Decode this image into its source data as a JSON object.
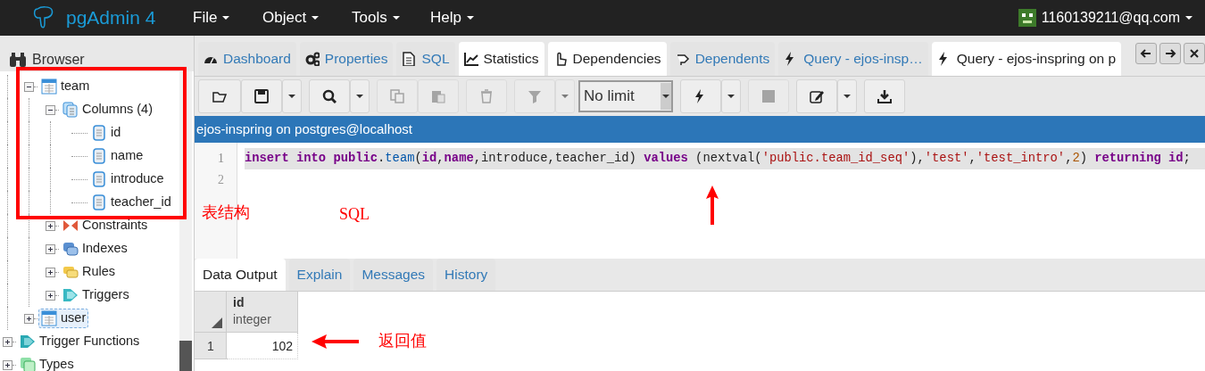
{
  "navbar": {
    "app_name": "pgAdmin 4",
    "menus": [
      "File",
      "Object",
      "Tools",
      "Help"
    ],
    "user": "1160139211@qq.com"
  },
  "browser": {
    "title": "Browser",
    "tables": [
      {
        "label": "team",
        "kind": "table",
        "expanded": true,
        "selected": false,
        "children": [
          {
            "label": "Columns (4)",
            "kind": "columns",
            "expanded": true,
            "selected": false,
            "children": [
              {
                "label": "id",
                "kind": "column",
                "selected": false
              },
              {
                "label": "name",
                "kind": "column",
                "selected": false
              },
              {
                "label": "introduce",
                "kind": "column",
                "selected": false
              },
              {
                "label": "teacher_id",
                "kind": "column",
                "selected": false
              }
            ]
          },
          {
            "label": "Constraints",
            "kind": "constraints",
            "expanded": false,
            "selected": false
          },
          {
            "label": "Indexes",
            "kind": "indexes",
            "expanded": false,
            "selected": false
          },
          {
            "label": "Rules",
            "kind": "rules",
            "expanded": false,
            "selected": false
          },
          {
            "label": "Triggers",
            "kind": "triggers",
            "expanded": false,
            "selected": false
          }
        ]
      },
      {
        "label": "user",
        "kind": "table",
        "expanded": false,
        "selected": true
      }
    ],
    "schema_items": [
      {
        "label": "Trigger Functions",
        "kind": "trigger_functions",
        "expanded": false,
        "selected": false
      },
      {
        "label": "Types",
        "kind": "types",
        "expanded": false,
        "selected": false
      }
    ]
  },
  "tabs": [
    {
      "label": "Dashboard",
      "kind": "dashboard",
      "selected": false
    },
    {
      "label": "Properties",
      "kind": "properties",
      "selected": false
    },
    {
      "label": "SQL",
      "kind": "sql",
      "selected": false
    },
    {
      "label": "Statistics",
      "kind": "statistics",
      "selected": true
    },
    {
      "label": "Dependencies",
      "kind": "dependencies",
      "selected": true
    },
    {
      "label": "Dependents",
      "kind": "dependents",
      "selected": false
    },
    {
      "label": "Query - ejos-insp…",
      "kind": "query",
      "selected": false
    },
    {
      "label": "Query - ejos-inspring on p",
      "kind": "query",
      "selected": true
    }
  ],
  "toolbar": {
    "row_limit": "No limit"
  },
  "connection": "ejos-inspring on postgres@localhost",
  "editor": {
    "lines": [
      {
        "number": "1",
        "active": true
      },
      {
        "number": "2",
        "active": false
      }
    ],
    "tokens": [
      {
        "kind": "keyword",
        "text": "insert "
      },
      {
        "kind": "keyword",
        "text": "into "
      },
      {
        "kind": "keyword",
        "text": "public"
      },
      {
        "kind": "plain",
        "text": "."
      },
      {
        "kind": "name",
        "text": "team"
      },
      {
        "kind": "plain",
        "text": "("
      },
      {
        "kind": "keyword",
        "text": "id"
      },
      {
        "kind": "plain",
        "text": ","
      },
      {
        "kind": "keyword",
        "text": "name"
      },
      {
        "kind": "plain",
        "text": ",introduce,teacher_id) "
      },
      {
        "kind": "keyword",
        "text": "values"
      },
      {
        "kind": "plain",
        "text": " (nextval("
      },
      {
        "kind": "string",
        "text": "'public.team_id_seq'"
      },
      {
        "kind": "plain",
        "text": "),"
      },
      {
        "kind": "string",
        "text": "'test'"
      },
      {
        "kind": "plain",
        "text": ","
      },
      {
        "kind": "string",
        "text": "'test_intro'"
      },
      {
        "kind": "plain",
        "text": ","
      },
      {
        "kind": "number",
        "text": "2"
      },
      {
        "kind": "plain",
        "text": ") "
      },
      {
        "kind": "keyword",
        "text": "returning "
      },
      {
        "kind": "keyword",
        "text": "id"
      },
      {
        "kind": "plain",
        "text": ";"
      }
    ]
  },
  "result_tabs": [
    {
      "label": "Data Output",
      "selected": true
    },
    {
      "label": "Explain",
      "selected": false
    },
    {
      "label": "Messages",
      "selected": false
    },
    {
      "label": "History",
      "selected": false
    }
  ],
  "grid": {
    "columns": [
      {
        "name": "id",
        "type": "integer"
      }
    ],
    "rows": [
      {
        "number": "1",
        "cells": [
          "102"
        ]
      }
    ]
  },
  "annotations": [
    {
      "kind": "box"
    },
    {
      "kind": "label",
      "text": "表结构"
    },
    {
      "kind": "label",
      "text": "SQL"
    },
    {
      "kind": "arrow_up"
    },
    {
      "kind": "arrow_left"
    },
    {
      "kind": "label",
      "text": "返回值"
    }
  ]
}
